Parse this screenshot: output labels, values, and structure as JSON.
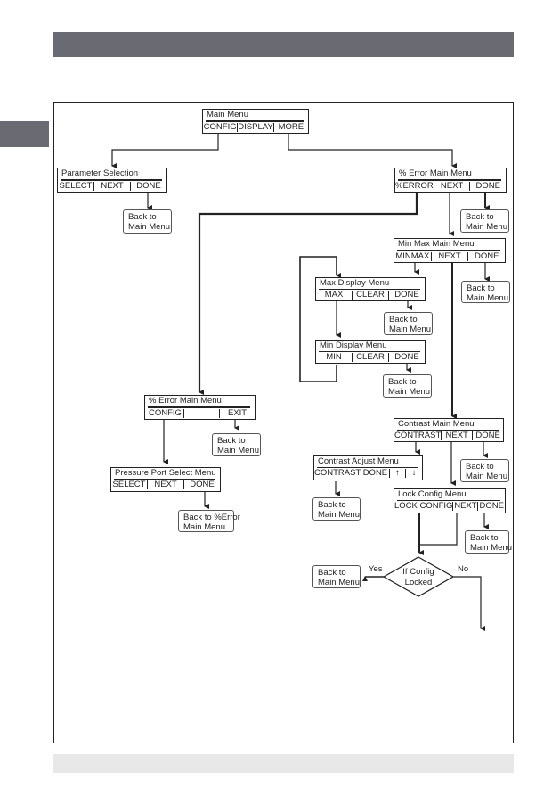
{
  "colors": {
    "header": "#6a6b72",
    "footer": "#e8e8e8",
    "line": "#222222"
  },
  "main_menu": {
    "title": "Main Menu",
    "options": [
      "CONFIG",
      "DISPLAY",
      "MORE"
    ]
  },
  "parameter_selection": {
    "title": "Parameter Selection",
    "options": [
      "SELECT",
      "NEXT",
      "DONE"
    ]
  },
  "error_main_menu_top": {
    "title": "% Error Main Menu",
    "options": [
      "%ERROR",
      "NEXT",
      "DONE"
    ]
  },
  "minmax_main_menu": {
    "title": "Min Max  Main Menu",
    "options": [
      "MINMAX",
      "NEXT",
      "DONE"
    ]
  },
  "max_display_menu": {
    "title": "Max Display Menu",
    "options": [
      "MAX",
      "CLEAR",
      "DONE"
    ]
  },
  "min_display_menu": {
    "title": "Min Display Menu",
    "options": [
      "MIN",
      "CLEAR",
      "DONE"
    ]
  },
  "error_main_menu_left": {
    "title": "% Error Main Menu",
    "options": [
      "CONFIG",
      "",
      "EXIT"
    ]
  },
  "pressure_port_menu": {
    "title": "Pressure Port Select Menu",
    "options": [
      "SELECT",
      "NEXT",
      "DONE"
    ]
  },
  "contrast_main_menu": {
    "title": "Contrast  Main Menu",
    "options": [
      "CONTRAST",
      "NEXT",
      "DONE"
    ]
  },
  "contrast_adjust_menu": {
    "title": "Contrast Adjust Menu",
    "options": [
      "CONTRAST",
      "DONE",
      "↑",
      "↓"
    ]
  },
  "lock_config_menu": {
    "title": "Lock Config  Menu",
    "options": [
      "LOCK CONFIG",
      "NEXT",
      "DONE"
    ]
  },
  "back_main": "Back to\nMain Menu",
  "back_error": "Back to %Error\nMain Menu",
  "decision": {
    "text_line1": "If Config",
    "text_line2": "Locked",
    "yes": "Yes",
    "no": "No"
  }
}
